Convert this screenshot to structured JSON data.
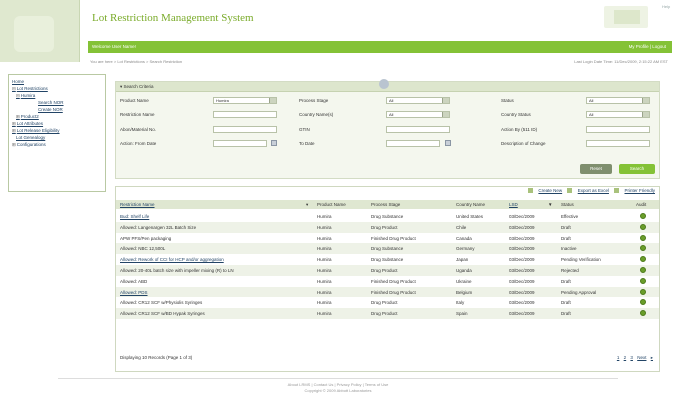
{
  "app": {
    "title": "Lot Restriction Management System",
    "top_right_mini": "Help"
  },
  "greenbar": {
    "welcome": "Welcome User Name!",
    "links": "My Profile | Logout"
  },
  "subbar": {
    "breadcrumb": "You are here > Lot Restrictions > Search Restriction",
    "last_login": "Last Login Date Time: 11/Dec/2009, 2:15:22 AM EST"
  },
  "sidebar": {
    "items": [
      {
        "label": "Home",
        "level": 0,
        "toggle": "",
        "link": true
      },
      {
        "label": "Lot Restrictions",
        "level": 0,
        "toggle": "⊟",
        "link": true
      },
      {
        "label": "Humira",
        "level": 1,
        "toggle": "⊟",
        "link": true
      },
      {
        "label": "Search NOR",
        "level": 2,
        "toggle": "",
        "link": true
      },
      {
        "label": "Create NOR",
        "level": 2,
        "toggle": "",
        "link": true
      },
      {
        "label": "Product2",
        "level": 1,
        "toggle": "⊞",
        "link": true
      },
      {
        "label": "Lot Attributes",
        "level": 0,
        "toggle": "⊞",
        "link": true
      },
      {
        "label": "Lot Release Eligibility",
        "level": 0,
        "toggle": "⊞",
        "link": true
      },
      {
        "label": "Lot Genealogy",
        "level": 0,
        "toggle": "",
        "link": true
      },
      {
        "label": "Configurations",
        "level": 0,
        "toggle": "⊞",
        "link": false
      }
    ]
  },
  "search": {
    "header": "Search Criteria",
    "labels": {
      "product_name": "Product Name",
      "process_stage": "Process Stage",
      "status": "Status",
      "restriction_name": "Restriction Name",
      "country_names": "Country Name(s)",
      "country_status": "Country Status",
      "abon_material": "Abon/Material No.",
      "gtin": "GTIN",
      "action_by": "Action By (511 ID)",
      "action_from_date": "Action: From Date",
      "to_date": "To Date",
      "description_of_change": "Description of Change"
    },
    "values": {
      "product_name": "Humira",
      "process_stage": "All",
      "status": "All",
      "country_names": "All",
      "country_status": "All"
    },
    "reset_label": "Reset",
    "search_label": "Search"
  },
  "results": {
    "tools": {
      "create_new": "Create New",
      "export_excel": "Export as Excel",
      "printer_friendly": "Printer Friendly"
    },
    "columns": {
      "restriction_name": "Restriction Name",
      "product_name": "Product Name",
      "process_stage": "Process Stage",
      "country_name": "Country Name",
      "lsd": "LSD",
      "status": "Status",
      "audit": "Audit"
    },
    "rows": [
      {
        "name": "Bud: Shelf Life",
        "product": "Humira",
        "stage": "Drug Substance",
        "country": "United States",
        "date": "03/Dec/2009",
        "status": "Effective",
        "link": true
      },
      {
        "name": "Allowed: Langenargen 32L Batch Size",
        "product": "Humira",
        "stage": "Drug Product",
        "country": "Chile",
        "date": "03/Dec/2009",
        "status": "Draft",
        "link": false
      },
      {
        "name": "APW PFS/Pen packaging",
        "product": "Humira",
        "stage": "Finished Drug Product",
        "country": "Canada",
        "date": "03/Dec/2009",
        "status": "Draft",
        "link": false
      },
      {
        "name": "Allowed: NBC 12,500L",
        "product": "Humira",
        "stage": "Drug Substance",
        "country": "Germany",
        "date": "03/Dec/2009",
        "status": "Inactive",
        "link": false
      },
      {
        "name": "Allowed: Rework of CCI for HCP and/or aggregation",
        "product": "Humira",
        "stage": "Drug Substance",
        "country": "Japan",
        "date": "03/Dec/2009",
        "status": "Pending Verification",
        "link": true
      },
      {
        "name": "Allowed: 20-40L batch size with impeller mixing (R) to LN",
        "product": "Humira",
        "stage": "Drug Product",
        "country": "Uganda",
        "date": "03/Dec/2009",
        "status": "Rejected",
        "link": false
      },
      {
        "name": "Allowed: ABD",
        "product": "Humira",
        "stage": "Finished Drug Product",
        "country": "Ukraine",
        "date": "03/Dec/2009",
        "status": "Draft",
        "link": false
      },
      {
        "name": "Allowed: PDS",
        "product": "Humira",
        "stage": "Finished Drug Product",
        "country": "Belgium",
        "date": "03/Dec/2009",
        "status": "Pending Approval",
        "link": true
      },
      {
        "name": "Allowed: CR12 SCF w/Physiolis Syringes",
        "product": "Humira",
        "stage": "Drug Product",
        "country": "Italy",
        "date": "03/Dec/2009",
        "status": "Draft",
        "link": false
      },
      {
        "name": "Allowed: CR12 SCF w/BD Hypak Syringes",
        "product": "Humira",
        "stage": "Drug Product",
        "country": "Spain",
        "date": "03/Dec/2009",
        "status": "Draft",
        "link": false
      }
    ],
    "footer_info": "Displaying 10 Records (Page 1 of 3)",
    "pager": [
      "1",
      "2",
      "3",
      "Next"
    ]
  },
  "footer": {
    "links": "About LRMS | Contact Us | Privacy Policy | Terms of Use",
    "copyright": "Copyright © 2009 Abbott Laboratories"
  }
}
